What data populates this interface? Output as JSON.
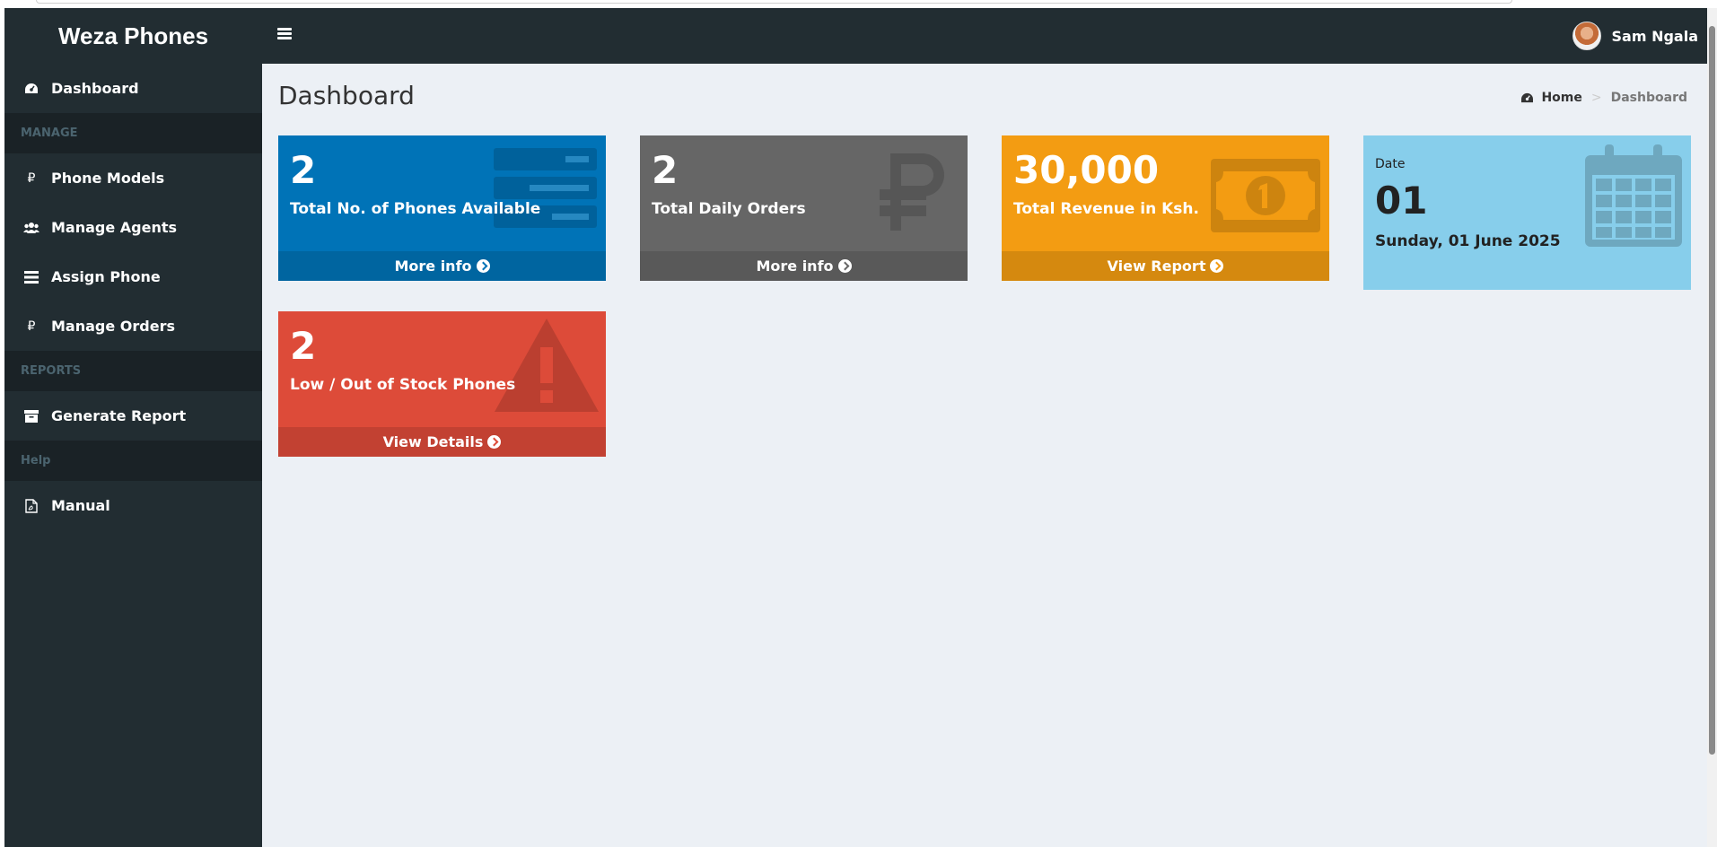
{
  "app": {
    "brand": "Weza Phones"
  },
  "header": {
    "user_name": "Sam Ngala"
  },
  "sidebar": {
    "items": [
      {
        "label": "Dashboard",
        "icon": "dashboard-icon"
      },
      {
        "header": "MANAGE"
      },
      {
        "label": "Phone Models",
        "icon": "ruble-icon"
      },
      {
        "label": "Manage Agents",
        "icon": "users-icon"
      },
      {
        "label": "Assign Phone",
        "icon": "tasks-icon"
      },
      {
        "label": "Manage Orders",
        "icon": "ruble-icon"
      },
      {
        "header": "REPORTS"
      },
      {
        "label": "Generate Report",
        "icon": "archive-icon"
      },
      {
        "header": "Help"
      },
      {
        "label": "Manual",
        "icon": "file-pdf-icon"
      }
    ]
  },
  "page": {
    "title": "Dashboard",
    "breadcrumb": {
      "home": "Home",
      "separator": ">",
      "current": "Dashboard"
    }
  },
  "cards": {
    "phones_available": {
      "value": "2",
      "caption": "Total No. of Phones Available",
      "link": "More info",
      "color": "#0073b7"
    },
    "daily_orders": {
      "value": "2",
      "caption": "Total Daily Orders",
      "link": "More info",
      "color": "#666666"
    },
    "revenue": {
      "value": "30,000",
      "caption": "Total Revenue in Ksh.",
      "link": "View Report",
      "color": "#f39c12"
    },
    "date": {
      "label": "Date",
      "day": "01",
      "full": "Sunday, 01 June 2025",
      "color": "#87ceeb"
    },
    "low_stock": {
      "value": "2",
      "caption": "Low / Out of Stock Phones",
      "link": "View Details",
      "color": "#dd4b39"
    }
  }
}
